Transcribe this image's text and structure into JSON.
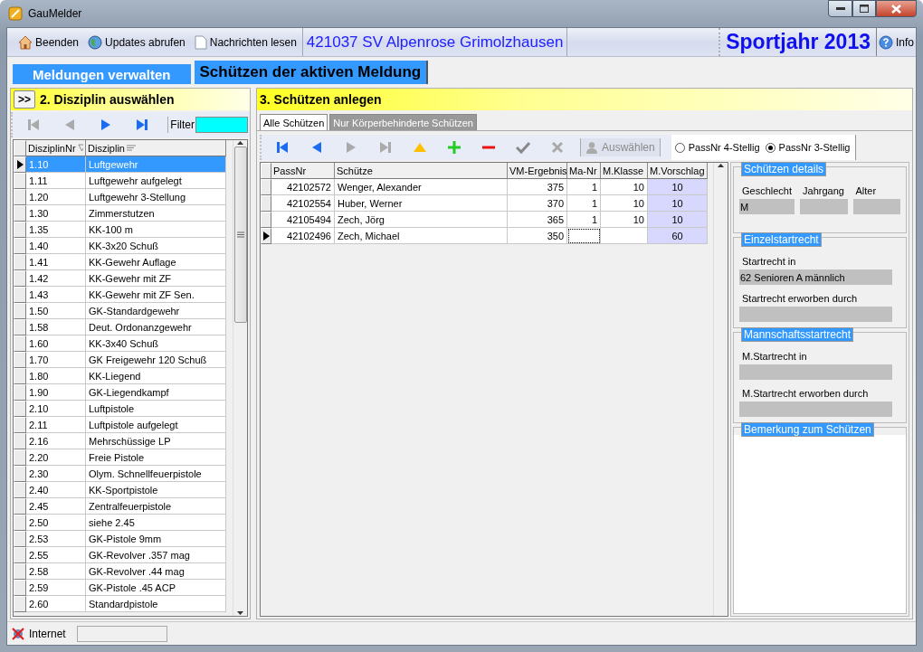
{
  "window": {
    "title": "GauMelder"
  },
  "toolbar": {
    "buttons": [
      {
        "kind": "home",
        "label": "Beenden"
      },
      {
        "kind": "globe",
        "label": "Updates abrufen"
      },
      {
        "kind": "document",
        "label": "Nachrichten lesen"
      }
    ],
    "club": "421037  SV Alpenrose Grimolzhausen",
    "season": "Sportjahr 2013",
    "info": "Info"
  },
  "main_tabs": [
    {
      "label": "Meldungen verwalten",
      "selected": false
    },
    {
      "label": "Schützen der aktiven Meldung",
      "selected": true
    }
  ],
  "discipline_panel": {
    "expand": ">>",
    "title": "2. Disziplin auswählen",
    "nav": [
      {
        "kind": "first",
        "disabled": true
      },
      {
        "kind": "prev",
        "disabled": true
      },
      {
        "kind": "next",
        "disabled": false
      },
      {
        "kind": "last",
        "disabled": false
      }
    ],
    "filter_label": "Filter",
    "columns": [
      "DisziplinNr",
      "Disziplin"
    ],
    "rows": [
      {
        "nr": "1.10",
        "name": "Luftgewehr",
        "selected": true
      },
      {
        "nr": "1.11",
        "name": "Luftgewehr aufgelegt",
        "selected": false
      },
      {
        "nr": "1.20",
        "name": "Luftgewehr 3-Stellung",
        "selected": false
      },
      {
        "nr": "1.30",
        "name": "Zimmerstutzen",
        "selected": false
      },
      {
        "nr": "1.35",
        "name": "KK-100 m",
        "selected": false
      },
      {
        "nr": "1.40",
        "name": "KK-3x20 Schuß",
        "selected": false
      },
      {
        "nr": "1.41",
        "name": "KK-Gewehr Auflage",
        "selected": false
      },
      {
        "nr": "1.42",
        "name": "KK-Gewehr mit ZF",
        "selected": false
      },
      {
        "nr": "1.43",
        "name": "KK-Gewehr mit ZF Sen.",
        "selected": false
      },
      {
        "nr": "1.50",
        "name": "GK-Standardgewehr",
        "selected": false
      },
      {
        "nr": "1.58",
        "name": "Deut. Ordonanzgewehr",
        "selected": false
      },
      {
        "nr": "1.60",
        "name": "KK-3x40 Schuß",
        "selected": false
      },
      {
        "nr": "1.70",
        "name": "GK Freigewehr 120 Schuß",
        "selected": false
      },
      {
        "nr": "1.80",
        "name": "KK-Liegend",
        "selected": false
      },
      {
        "nr": "1.90",
        "name": "GK-Liegendkampf",
        "selected": false
      },
      {
        "nr": "2.10",
        "name": "Luftpistole",
        "selected": false
      },
      {
        "nr": "2.11",
        "name": "Luftpistole aufgelegt",
        "selected": false
      },
      {
        "nr": "2.16",
        "name": "Mehrschüssige LP",
        "selected": false
      },
      {
        "nr": "2.20",
        "name": "Freie Pistole",
        "selected": false
      },
      {
        "nr": "2.30",
        "name": "Olym. Schnellfeuerpistole",
        "selected": false
      },
      {
        "nr": "2.40",
        "name": "KK-Sportpistole",
        "selected": false
      },
      {
        "nr": "2.45",
        "name": "Zentralfeuerpistole",
        "selected": false
      },
      {
        "nr": "2.50",
        "name": "siehe 2.45",
        "selected": false
      },
      {
        "nr": "2.53",
        "name": "GK-Pistole 9mm",
        "selected": false
      },
      {
        "nr": "2.55",
        "name": "GK-Revolver .357 mag",
        "selected": false
      },
      {
        "nr": "2.58",
        "name": "GK-Revolver .44 mag",
        "selected": false
      },
      {
        "nr": "2.59",
        "name": "GK-Pistole .45 ACP",
        "selected": false
      },
      {
        "nr": "2.60",
        "name": "Standardpistole",
        "selected": false
      }
    ]
  },
  "shooter_panel": {
    "title": "3. Schützen anlegen",
    "tabs": [
      {
        "label": "Alle Schützen",
        "selected": true
      },
      {
        "label": "Nur Körperbehinderte Schützen",
        "selected": false
      }
    ],
    "tools": [
      {
        "kind": "first",
        "disabled": false
      },
      {
        "kind": "prev",
        "disabled": false
      },
      {
        "kind": "next",
        "disabled": true
      },
      {
        "kind": "last",
        "disabled": true
      },
      {
        "kind": "up",
        "disabled": false
      },
      {
        "kind": "add",
        "disabled": false
      },
      {
        "kind": "remove",
        "disabled": false
      },
      {
        "kind": "confirm",
        "disabled": true
      },
      {
        "kind": "cancel",
        "disabled": true
      }
    ],
    "select_button": {
      "label": "Auswählen",
      "disabled": true
    },
    "options": [
      {
        "label": "PassNr 4-Stellig",
        "selected": false
      },
      {
        "label": "PassNr 3-Stellig",
        "selected": true
      }
    ],
    "columns": [
      "PassNr",
      "Schütze",
      "VM-Ergebnis",
      "Ma-Nr",
      "M.Klasse",
      "M.Vorschlag"
    ],
    "rows": [
      {
        "cells": [
          "42102572",
          "Wenger, Alexander",
          "375",
          "1",
          "10",
          "10"
        ],
        "selected": false
      },
      {
        "cells": [
          "42102554",
          "Huber, Werner",
          "370",
          "1",
          "10",
          "10"
        ],
        "selected": false
      },
      {
        "cells": [
          "42105494",
          "Zech, Jörg",
          "365",
          "1",
          "10",
          "10"
        ],
        "selected": false
      },
      {
        "cells": [
          "42102496",
          "Zech, Michael",
          "350",
          "",
          "",
          "60"
        ],
        "selected": true
      }
    ]
  },
  "details": {
    "groups": [
      {
        "title": "Schützen details",
        "kind": "inline",
        "fields": [
          {
            "label": "Geschlecht",
            "value": "M"
          },
          {
            "label": "Jahrgang"
          },
          {
            "label": "Alter"
          }
        ]
      },
      {
        "title": "Einzelstartrecht",
        "kind": "stacked",
        "fields": [
          {
            "label": "Startrecht in",
            "value": "62 Senioren A männlich"
          },
          {
            "label": "Startrecht erworben durch"
          }
        ]
      },
      {
        "title": "Mannschaftsstartrecht",
        "kind": "stacked",
        "fields": [
          {
            "label": "M.Startrecht in"
          },
          {
            "label": "M.Startrecht erworben durch"
          }
        ]
      },
      {
        "title": "Bemerkung zum Schützen",
        "kind": "memo"
      }
    ]
  },
  "status_bar": {
    "connection": "Internet"
  }
}
